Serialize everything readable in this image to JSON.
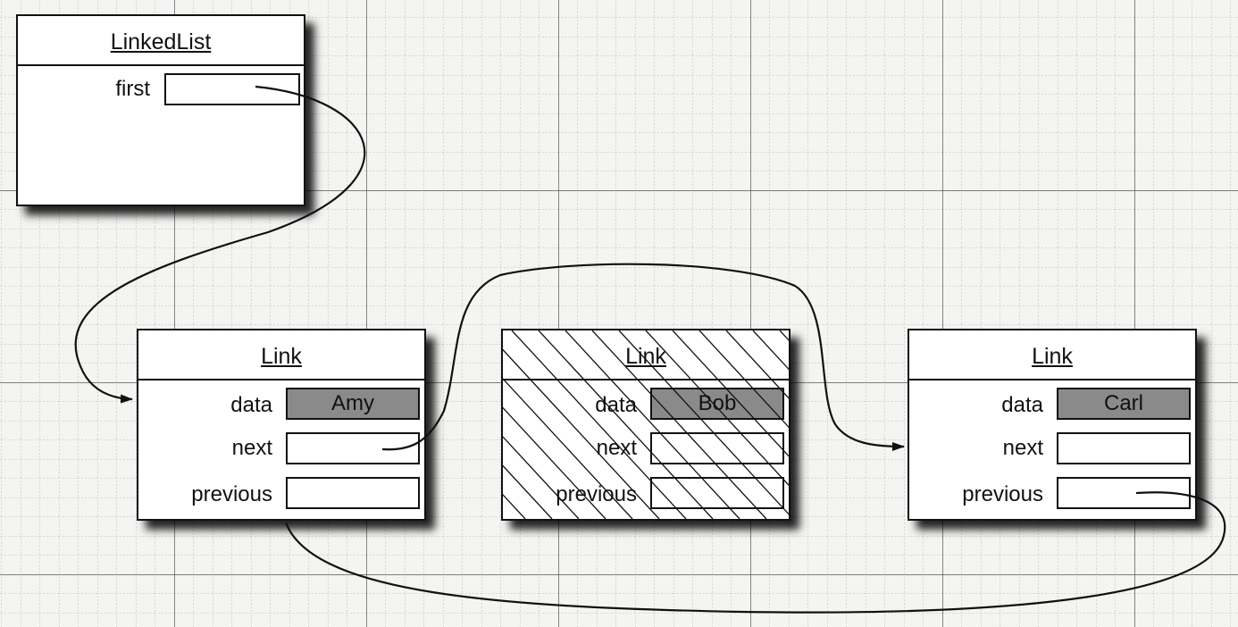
{
  "linked_list": {
    "title": "LinkedList",
    "first_label": "first"
  },
  "links": [
    {
      "title": "Link",
      "data_label": "data",
      "data_value": "Amy",
      "next_label": "next",
      "previous_label": "previous"
    },
    {
      "title": "Link",
      "data_label": "data",
      "data_value": "Bob",
      "next_label": "next",
      "previous_label": "previous",
      "removed": true
    },
    {
      "title": "Link",
      "data_label": "data",
      "data_value": "Carl",
      "next_label": "next",
      "previous_label": "previous"
    }
  ]
}
